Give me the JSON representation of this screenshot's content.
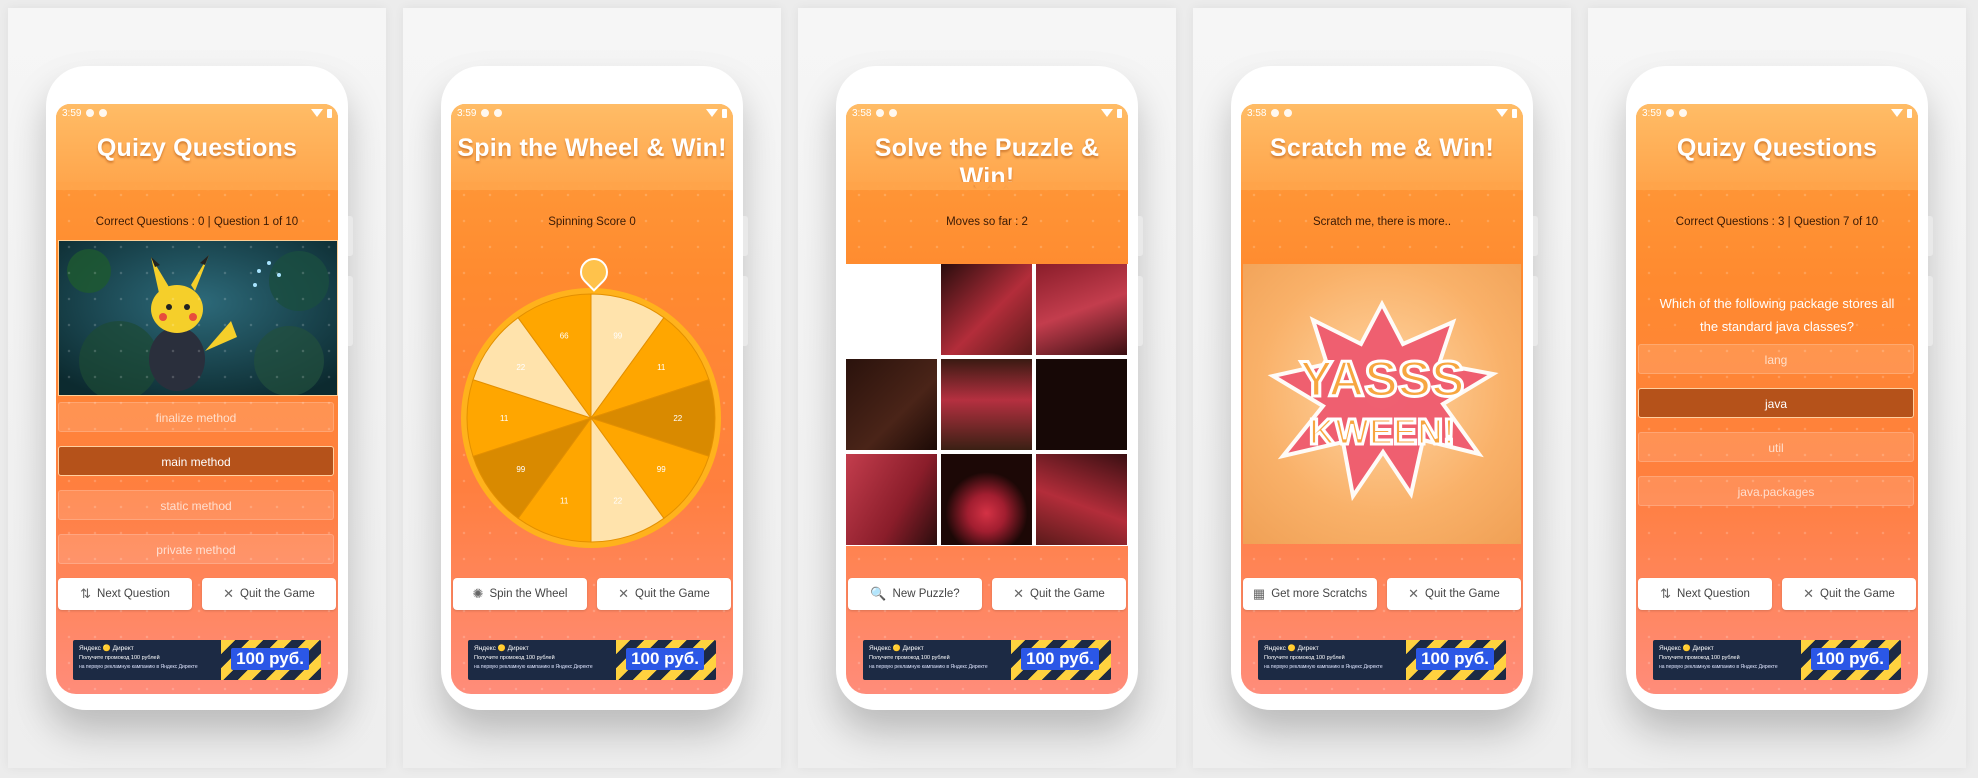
{
  "screens": [
    {
      "title": "Quizy Questions",
      "status_time": "3:59",
      "subline": "Correct Questions :  0   |   Question 1 of 10",
      "answers": [
        "finalize method",
        "main method",
        "static method",
        "private method"
      ],
      "selected_index": 1,
      "btn_left": "Next Question",
      "btn_right": "Quit the  Game"
    },
    {
      "title": "Spin the Wheel & Win!",
      "status_time": "3:59",
      "subline": "Spinning Score 0",
      "wheel_labels": [
        "99",
        "11",
        "22",
        "99",
        "22",
        "11",
        "99",
        "11",
        "22",
        "66"
      ],
      "btn_left": "Spin the Wheel",
      "btn_right": "Quit the  Game"
    },
    {
      "title": "Solve the Puzzle & Win!",
      "status_time": "3:58",
      "subline": "Moves so far : 2",
      "btn_left": "New Puzzle?",
      "btn_right": "Quit the  Game"
    },
    {
      "title": "Scratch me & Win!",
      "status_time": "3:58",
      "subline": "Scratch me, there is more..",
      "scratch_text_1": "YASSS",
      "scratch_text_2": "KWEEN!",
      "btn_left": "Get more Scratchs",
      "btn_right": "Quit the  Game"
    },
    {
      "title": "Quizy Questions",
      "status_time": "3:59",
      "subline": "Correct Questions :  3   |   Question 7 of 10",
      "question": "Which of the following package stores all the standard java classes?",
      "answers": [
        "lang",
        "java",
        "util",
        "java.packages"
      ],
      "selected_index": 1,
      "btn_left": "Next Question",
      "btn_right": "Quit the  Game"
    }
  ],
  "ad": {
    "brand": "Яндекс 🟡 Директ",
    "line": "Получите промокод 100 рублей",
    "subline": "на первую рекламную кампанию в Яндекс Директе",
    "price": "100 руб."
  },
  "colors": {
    "header": "#ffa44a",
    "accent": "#ff8a2f",
    "selected": "#b5521a",
    "wheel_dark": "#d98a00",
    "wheel_mid": "#ffa600",
    "wheel_light": "#ffe3ac"
  }
}
